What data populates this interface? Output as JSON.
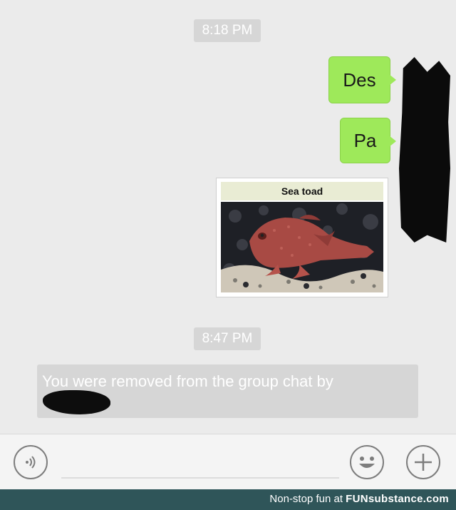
{
  "timestamps": [
    "8:18 PM",
    "8:47 PM"
  ],
  "messages": [
    {
      "side": "right",
      "text": "Des"
    },
    {
      "side": "right",
      "text": "Pa"
    }
  ],
  "image_message": {
    "caption": "Sea toad"
  },
  "system_notice": {
    "text": "You were removed from the group chat by"
  },
  "input_bar": {
    "voice_icon": "voice-icon",
    "emoji_icon": "emoji-icon",
    "plus_icon": "plus-icon"
  },
  "footer": {
    "prefix": "Non-stop fun at",
    "brand": "FUNsubstance.com"
  },
  "colors": {
    "chat_bg": "#ebebeb",
    "bubble_green": "#9ee95a",
    "timestamp_bg": "#d6d6d6",
    "footer_bg": "#2f5559"
  }
}
